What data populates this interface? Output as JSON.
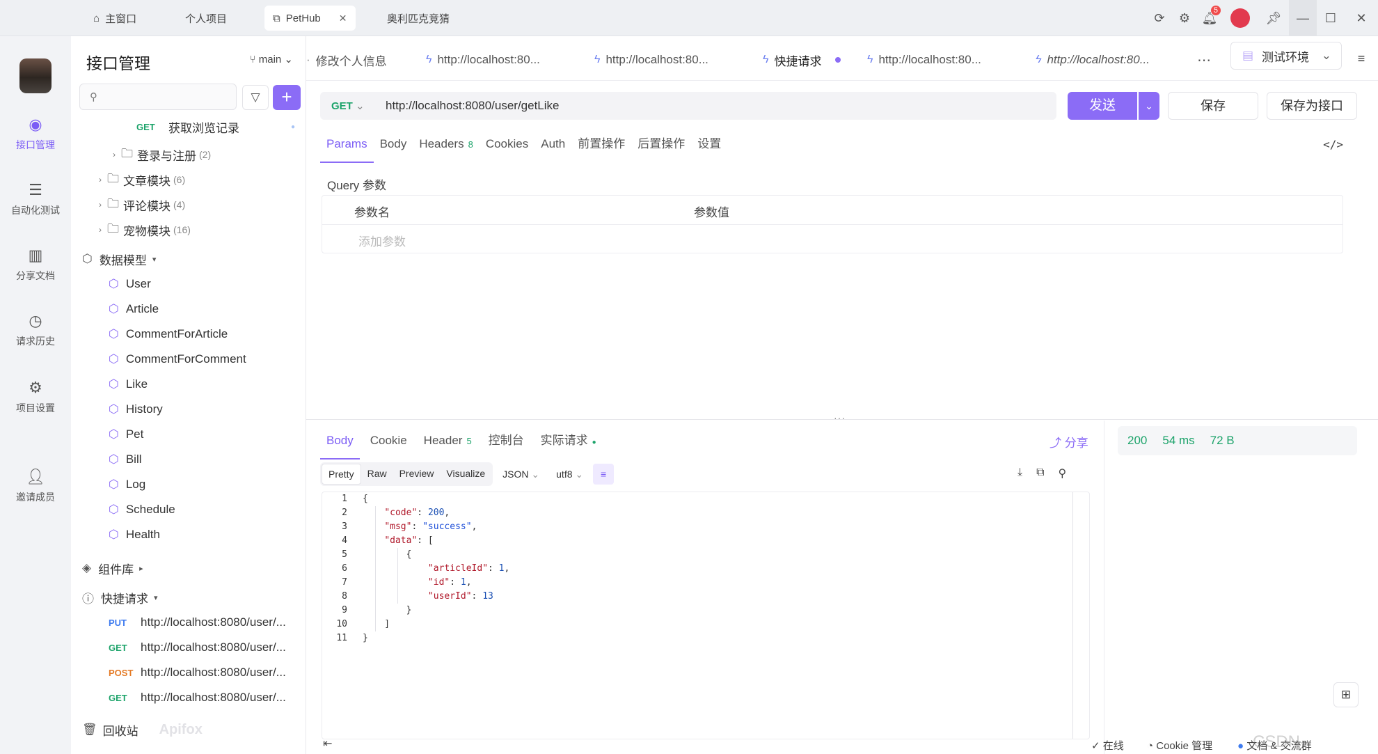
{
  "titlebar": {
    "tabs": [
      {
        "label": "主窗口",
        "icon": "home-icon"
      },
      {
        "label": "个人项目"
      },
      {
        "label": "PetHub",
        "icon": "external-link-icon"
      },
      {
        "label": "奥利匹克竞猜"
      }
    ],
    "notifications": "5"
  },
  "rail": {
    "items": [
      "接口管理",
      "自动化测试",
      "分享文档",
      "请求历史",
      "项目设置",
      "邀请成员"
    ]
  },
  "tree": {
    "title": "接口管理",
    "branch": "main",
    "rows": [
      {
        "method": "GET",
        "label": "获取浏览记录"
      },
      {
        "label": "登录与注册",
        "count": "(2)"
      },
      {
        "label": "文章模块",
        "count": "(6)"
      },
      {
        "label": "评论模块",
        "count": "(4)"
      },
      {
        "label": "宠物模块",
        "count": "(16)"
      }
    ],
    "models_title": "数据模型",
    "models": [
      "User",
      "Article",
      "CommentForArticle",
      "CommentForComment",
      "Like",
      "History",
      "Pet",
      "Bill",
      "Log",
      "Schedule",
      "Health"
    ],
    "components_title": "组件库",
    "quick_title": "快捷请求",
    "quick": [
      {
        "method": "PUT",
        "url": "http://localhost:8080/user/..."
      },
      {
        "method": "GET",
        "url": "http://localhost:8080/user/..."
      },
      {
        "method": "POST",
        "url": "http://localhost:8080/user/..."
      },
      {
        "method": "GET",
        "url": "http://localhost:8080/user/..."
      }
    ],
    "trash": "回收站",
    "brand": "Apifox"
  },
  "request_tabs": [
    "修改个人信息",
    "http://localhost:80...",
    "http://localhost:80...",
    "快捷请求",
    "http://localhost:80...",
    "http://localhost:80..."
  ],
  "env": "测试环境",
  "request": {
    "method": "GET",
    "url": "http://localhost:8080/user/getLike",
    "send": "发送",
    "save": "保存",
    "save_as": "保存为接口"
  },
  "subtabs": [
    {
      "label": "Params"
    },
    {
      "label": "Body"
    },
    {
      "label": "Headers",
      "n": "8"
    },
    {
      "label": "Cookies"
    },
    {
      "label": "Auth"
    },
    {
      "label": "前置操作"
    },
    {
      "label": "后置操作"
    },
    {
      "label": "设置"
    }
  ],
  "query": {
    "label": "Query 参数",
    "col_name": "参数名",
    "col_value": "参数值",
    "add": "添加参数"
  },
  "response": {
    "tabs": [
      {
        "label": "Body"
      },
      {
        "label": "Cookie"
      },
      {
        "label": "Header",
        "n": "5"
      },
      {
        "label": "控制台"
      },
      {
        "label": "实际请求"
      }
    ],
    "share": "分享",
    "status": "200",
    "time": "54 ms",
    "size": "72 B",
    "format_tabs": [
      "Pretty",
      "Raw",
      "Preview",
      "Visualize"
    ],
    "format": "JSON",
    "encoding": "utf8"
  },
  "code": [
    "{",
    "    \"code\": 200,",
    "    \"msg\": \"success\",",
    "    \"data\": [",
    "        {",
    "            \"articleId\": 1,",
    "            \"id\": 1,",
    "            \"userId\": 13",
    "        }",
    "    ]",
    "}"
  ],
  "status": {
    "online": "在线",
    "cookie": "Cookie 管理",
    "docs": "文档 & 交流群"
  },
  "watermark": "CSDN @QiliaoZhu",
  "colors": {
    "accent": "#8b6cf6",
    "get": "#1ca36a",
    "post": "#e47a25",
    "put": "#3e7bef"
  }
}
